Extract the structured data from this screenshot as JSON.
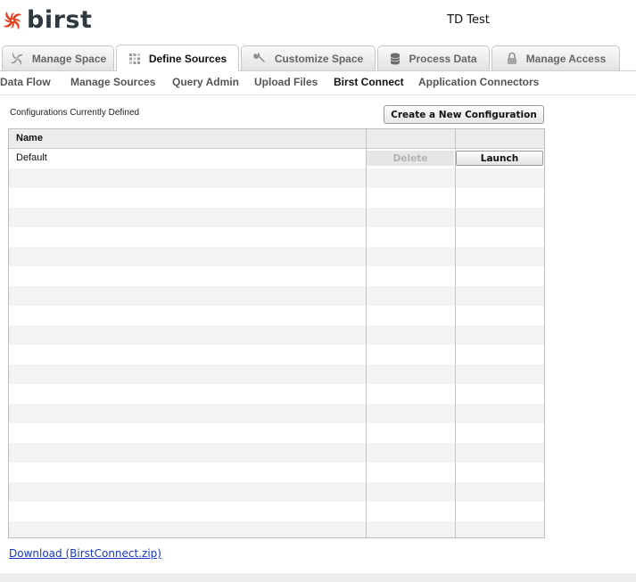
{
  "header": {
    "logo_text": "birst",
    "logo_color": "#e63d1e",
    "space_name": "TD Test"
  },
  "tabs": [
    {
      "label": "Manage Space",
      "icon": "pinwheel-icon",
      "active": false
    },
    {
      "label": "Define Sources",
      "icon": "grid-dots-icon",
      "active": true
    },
    {
      "label": "Customize Space",
      "icon": "wrench-icon",
      "active": false
    },
    {
      "label": "Process Data",
      "icon": "database-icon",
      "active": false
    },
    {
      "label": "Manage Access",
      "icon": "padlock-icon",
      "active": false
    }
  ],
  "subnav": [
    {
      "label": "Data Flow",
      "active": false
    },
    {
      "label": "Manage Sources",
      "active": false
    },
    {
      "label": "Query Admin",
      "active": false
    },
    {
      "label": "Upload Files",
      "active": false
    },
    {
      "label": "Birst Connect",
      "active": true
    },
    {
      "label": "Application Connectors",
      "active": false
    }
  ],
  "config": {
    "title": "Configurations Currently Defined",
    "create_button": "Create a New Configuration"
  },
  "grid": {
    "columns": [
      "Name",
      "",
      ""
    ],
    "rows": [
      {
        "name": "Default",
        "delete_label": "Delete",
        "launch_label": "Launch"
      }
    ]
  },
  "download_link": "Download (BirstConnect.zip)"
}
